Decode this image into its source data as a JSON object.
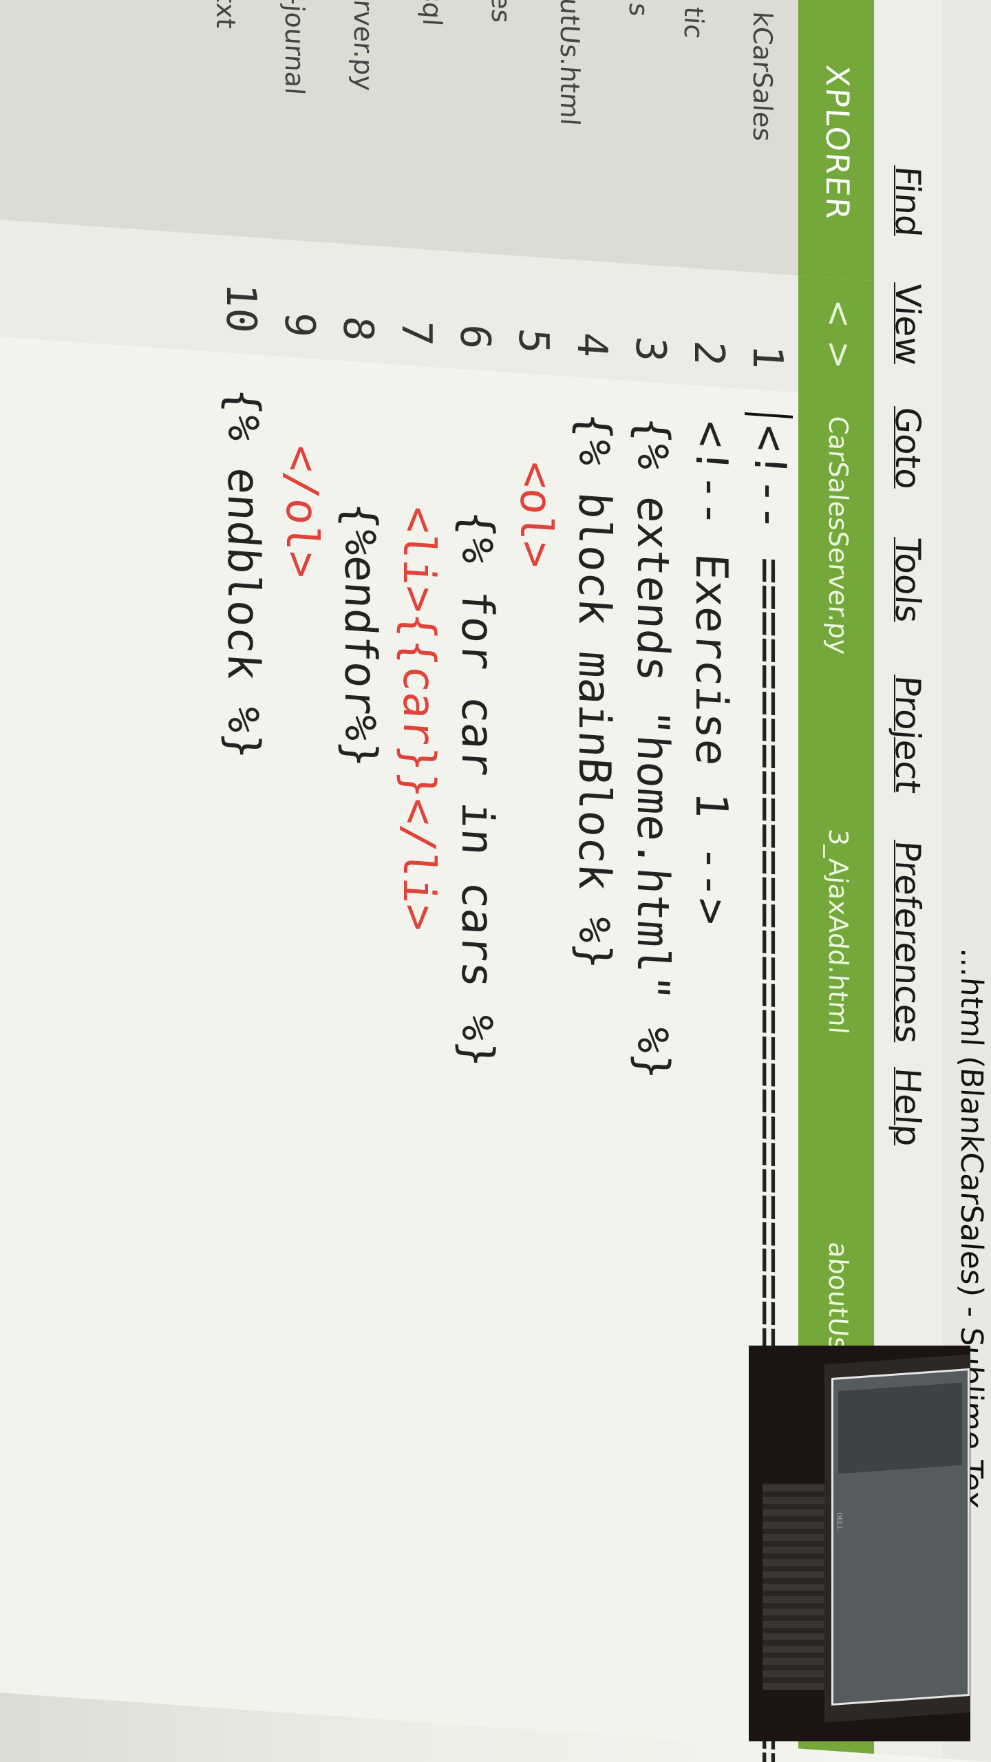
{
  "window": {
    "title": "...html (BlankCarSales) - Sublime Tex"
  },
  "menu": [
    "Find",
    "View",
    "Goto",
    "Tools",
    "Project",
    "Preferences",
    "Help"
  ],
  "sidebar": {
    "title": "XPLORER",
    "items": [
      "kCarSales",
      "tic",
      "s",
      "utUs.html",
      "es",
      "sql",
      "erver.py",
      "b-journal",
      "t.txt"
    ]
  },
  "tabs": [
    "CarSalesServer.py",
    "3_AjaxAdd.html",
    "aboutUs.html"
  ],
  "nav": {
    "back": "<",
    "forward": ">"
  },
  "editor": {
    "line_numbers": [
      "1",
      "2",
      "3",
      "4",
      "5",
      "6",
      "7",
      "8",
      "9",
      "10"
    ],
    "lines": [
      "<!-- ================================================",
      "<!-- Exercise 1 -->",
      "{% extends \"home.html\" %}",
      "{% block mainBlock %}",
      "  <ol>",
      "    {% for car in cars %}",
      "    <li>{{car}}</li>",
      "    {%endfor%}",
      "  </ol>",
      "{% endblock %}"
    ]
  },
  "pip": {
    "logo": "DELL"
  },
  "colors": {
    "accent_green": "#74a83a",
    "tag_red": "#e0433a",
    "editor_bg": "#f3f3ee"
  }
}
